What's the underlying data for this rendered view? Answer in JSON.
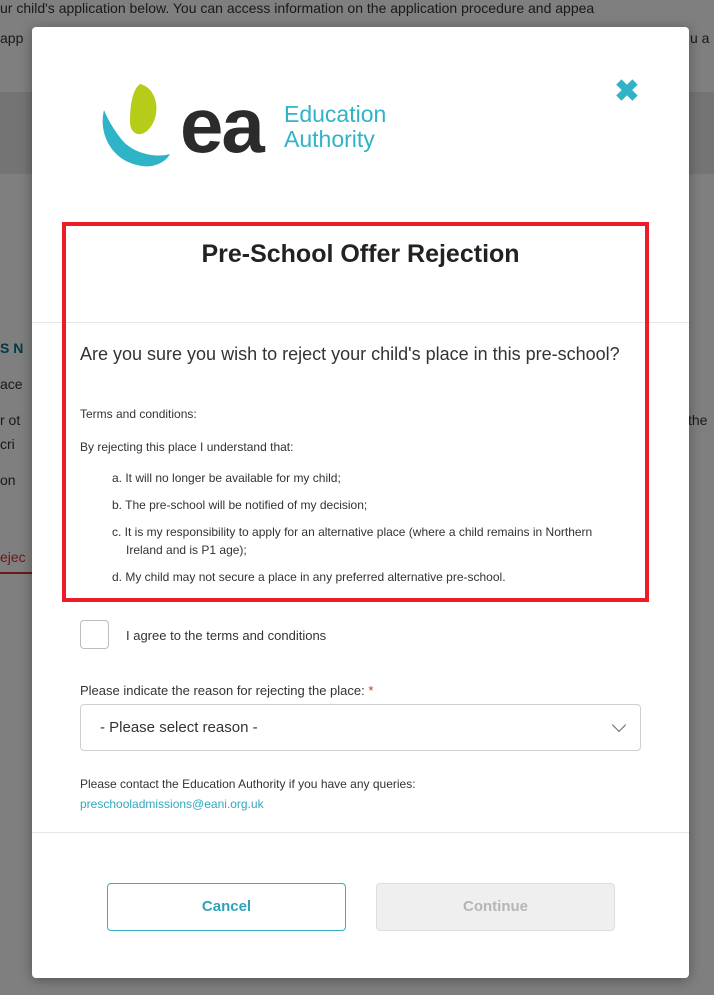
{
  "background": {
    "line1": "ur child's application below. You can access information on the application procedure and appea",
    "line2_left": "app",
    "line2_right": "u a",
    "frag_n": "S N",
    "frag_ace": "ace",
    "frag_rot": "r ot",
    "frag_cri": "cri",
    "frag_on": "on",
    "frag_rej": "ejec",
    "frag_the": "the"
  },
  "modal": {
    "logo": {
      "mark": "ea",
      "line1": "Education",
      "line2": "Authority",
      "colors": {
        "leaf_green": "#b5cc18",
        "leaf_blue": "#2fb3c7"
      }
    },
    "close_icon": "✖",
    "title": "Pre-School Offer Rejection",
    "question": "Are you sure you wish to reject your child's place in this pre-school?",
    "terms_heading": "Terms and conditions:",
    "terms_intro": "By rejecting this place I understand that:",
    "terms": [
      {
        "marker": "a.",
        "text": "It will no longer be available for my child;"
      },
      {
        "marker": "b.",
        "text": "The pre-school will be notified of my decision;"
      },
      {
        "marker": "c.",
        "text": "It is my responsibility to apply for an alternative place (where a child remains in Northern Ireland and is P1 age);"
      },
      {
        "marker": "d.",
        "text": "My child may not secure a place in any preferred alternative pre-school."
      }
    ],
    "agree_label": "I agree to the terms and conditions",
    "agree_checked": false,
    "reason_label": "Please indicate the reason for rejecting the place:",
    "required_mark": "*",
    "reason_select": {
      "selected": "- Please select reason -"
    },
    "contact_text": "Please contact the Education Authority if you have any queries:",
    "contact_email": "preschooladmissions@eani.org.uk",
    "cancel_label": "Cancel",
    "continue_label": "Continue",
    "continue_disabled": true,
    "highlight_color": "#ee1c25"
  }
}
